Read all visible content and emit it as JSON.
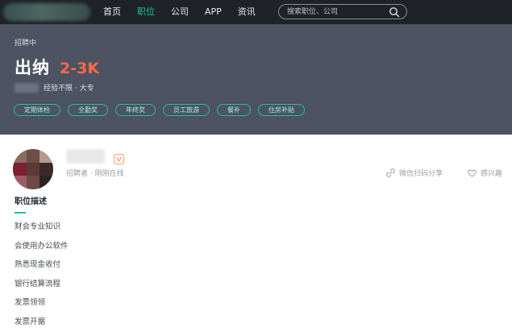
{
  "nav": {
    "items": [
      {
        "label": "首页",
        "active": false
      },
      {
        "label": "职位",
        "active": true
      },
      {
        "label": "公司",
        "active": false
      },
      {
        "label": "APP",
        "active": false
      },
      {
        "label": "资讯",
        "active": false
      }
    ],
    "search_placeholder": "搜索职位、公司",
    "search_icon": "search-icon"
  },
  "job": {
    "status": "招聘中",
    "title": "出纳",
    "salary": "2-3K",
    "requirements": "经验不限 · 大专",
    "tags": [
      "定期体检",
      "全勤奖",
      "年终奖",
      "员工旅游",
      "餐补",
      "住房补贴"
    ]
  },
  "recruiter": {
    "meta": "招聘者 · 刚刚在线",
    "badge_icon": "vip-badge-icon",
    "share_label": "微信扫码分享",
    "interest_label": "感兴趣"
  },
  "description": {
    "heading": "职位描述",
    "items": [
      "财会专业知识",
      "会使用办公软件",
      "熟悉现金收付",
      "银行结算流程",
      "发票领领",
      "发票开据"
    ]
  },
  "colors": {
    "topbar": "#1f2329",
    "header_bg": "#4d5362",
    "accent": "#19c5a4",
    "salary": "#fd6a47"
  }
}
